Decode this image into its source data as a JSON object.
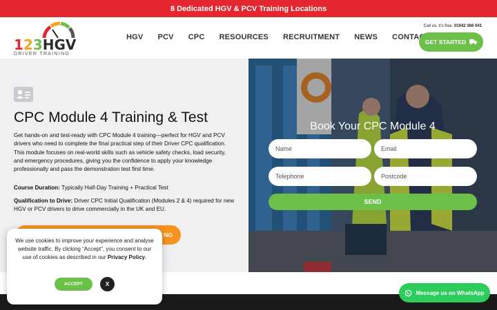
{
  "banner": {
    "text": "8 Dedicated HGV & PCV Training Locations",
    "color": "#e3262f"
  },
  "logo": {
    "digits": [
      "1",
      "2",
      "3"
    ],
    "brand": "HGV",
    "tagline": "DRIVER TRAINING"
  },
  "nav": {
    "items": [
      "HGV",
      "PCV",
      "CPC",
      "RESOURCES",
      "RECRUITMENT",
      "NEWS",
      "CONTACT"
    ]
  },
  "contact": {
    "prefix": "Call us, it's free.",
    "phone": "01942 366 041"
  },
  "cta": {
    "label": "GET STARTED",
    "icon": "truck-icon",
    "color": "#6cc04a"
  },
  "main": {
    "icon": "id-card-icon",
    "title": "CPC Module 4 Training & Test",
    "intro": "Get hands-on and test-ready with CPC Module 4 training—perfect for HGV and PCV drivers who need to complete the final practical step of their Driver CPC qualification. This module focuses on real-world skills such as vehicle safety checks, load security, and emergency procedures, giving you the confidence to apply your knowledge professionally and pass the demonstration test first time.",
    "duration_label": "Course Duration:",
    "duration_value": "Typically Half-Day Training + Practical Test",
    "qual_label": "Qualification to Drive:",
    "qual_value": "Driver CPC Initial Qualification (Modules 2 & 4) required for new HGV or PCV drivers to drive commercially in the UK and EU.",
    "button_label": "NG"
  },
  "form": {
    "title": "Book Your CPC Module 4",
    "name_placeholder": "Name",
    "email_placeholder": "Email",
    "telephone_placeholder": "Telephone",
    "postcode_placeholder": "Postcode",
    "send_label": "SEND"
  },
  "cookie": {
    "text_before": "We use cookies to improve your experience and analyse website traffic. By clicking “Accept”, you consent to our use of cookies as described in our",
    "policy_link": "Privacy Policy",
    "text_after": ".",
    "accept_label": "ACCEPT",
    "close_label": "X"
  },
  "whatsapp": {
    "label": "Message us on WhatsApp",
    "icon": "whatsapp-icon",
    "color": "#2ecc5c"
  }
}
